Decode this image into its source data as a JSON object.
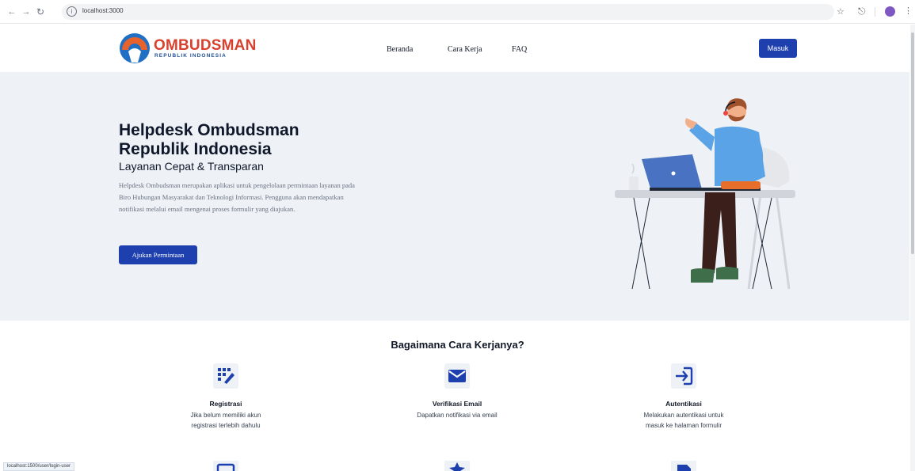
{
  "browser": {
    "url": "localhost:3000",
    "status_url": "localhost:1500/user/login-user",
    "icons": [
      "back-icon",
      "forward-icon",
      "reload-icon",
      "info-icon",
      "star-icon",
      "extensions-icon",
      "profile-icon",
      "menu-icon"
    ]
  },
  "header": {
    "logo_word": "OMBUDSMAN",
    "logo_sub": "REPUBLIK INDONESIA",
    "nav": [
      {
        "label": "Beranda"
      },
      {
        "label": "Cara Kerja"
      },
      {
        "label": "FAQ"
      }
    ],
    "login_label": "Masuk"
  },
  "hero": {
    "title": "Helpdesk Ombudsman Republik Indonesia",
    "subtitle": "Layanan Cepat & Transparan",
    "description": "Helpdesk Ombudsman merupakan aplikasi untuk pengelolaan permintaan layanan pada Biro Hubungan Masyarakat dan Teknologi Informasi. Pengguna akan mendapatkan notifikasi melalui email mengenai proses formulir yang diajukan.",
    "cta_label": "Ajukan Permintaan"
  },
  "how": {
    "title": "Bagaimana Cara Kerjanya?",
    "steps": [
      {
        "title": "Registrasi",
        "desc": "Jika belum memiliki akun registrasi terlebih dahulu",
        "icon": "registration-icon"
      },
      {
        "title": "Verifikasi Email",
        "desc": "Dapatkan notifikasi via email",
        "icon": "mail-icon"
      },
      {
        "title": "Autentikasi",
        "desc": "Melakukan autentikasi untuk masuk ke halaman formulir",
        "icon": "login-icon"
      }
    ]
  },
  "colors": {
    "primary": "#1e40af",
    "hero_bg": "#eef2f7",
    "logo_red": "#d9412e",
    "logo_blue": "#1f4e99"
  }
}
